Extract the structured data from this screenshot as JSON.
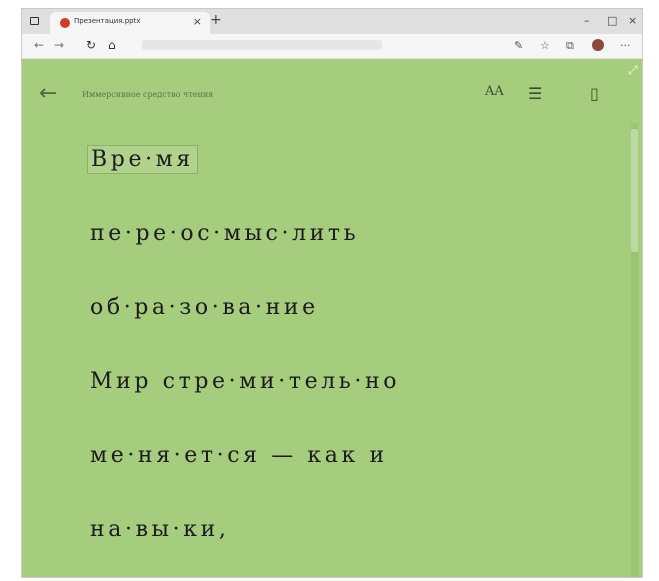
{
  "browser": {
    "tab_title": "Презентация.pptx",
    "tab_close": "×",
    "new_tab": "+",
    "window_buttons": [
      "–",
      "□",
      "×"
    ],
    "nav_icons": [
      "back-arrow-icon",
      "forward-arrow-icon",
      "refresh-icon",
      "home-icon"
    ],
    "toolbar_icons": [
      "read-aloud-icon",
      "favorite-icon",
      "collections-icon",
      "profile-icon",
      "more-icon"
    ],
    "more_label": "···"
  },
  "reader": {
    "title": "Иммерсивное средство чтения",
    "background_color": "#a6cd7d",
    "text_color": "#1b1b1b",
    "icons": [
      "back-arrow-icon",
      "text-preferences-icon",
      "grammar-options-icon",
      "reading-preferences-icon",
      "expand-icon"
    ],
    "font_button_label": "AA",
    "lines": [
      "Вре·мя",
      "пе·ре·ос·мыс·лить",
      "об·ра·зо·ва·ние",
      "Мир стре·ми·тель·но",
      "ме·ня·ет·ся — как и",
      "на·вы·ки,"
    ]
  }
}
